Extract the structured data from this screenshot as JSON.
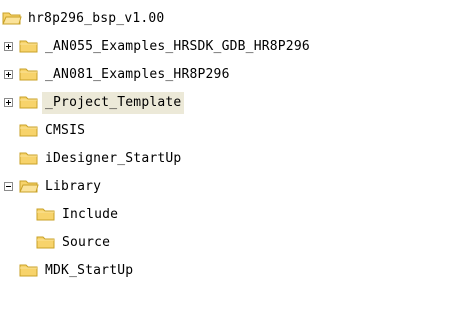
{
  "tree": {
    "root": {
      "label": "hr8p296_bsp_v1.00",
      "icon": "folder-open-icon"
    },
    "items": [
      {
        "label": "_AN055_Examples_HRSDK_GDB_HR8P296",
        "expander": "plus",
        "icon": "folder-icon"
      },
      {
        "label": "_AN081_Examples_HR8P296",
        "expander": "plus",
        "icon": "folder-icon"
      },
      {
        "label": "_Project_Template",
        "expander": "plus",
        "icon": "folder-icon",
        "selected": true
      },
      {
        "label": "CMSIS",
        "expander": "none",
        "icon": "folder-icon"
      },
      {
        "label": "iDesigner_StartUp",
        "expander": "none",
        "icon": "folder-icon"
      },
      {
        "label": "Library",
        "expander": "minus",
        "icon": "folder-open-icon"
      },
      {
        "label": "Include",
        "expander": "none",
        "icon": "folder-icon"
      },
      {
        "label": "Source",
        "expander": "none",
        "icon": "folder-icon"
      },
      {
        "label": "MDK_StartUp",
        "expander": "none",
        "icon": "folder-icon"
      }
    ],
    "colors": {
      "folder_fill": "#f7d36b",
      "folder_stroke": "#c9a227",
      "selection": "#ece9d8"
    }
  }
}
